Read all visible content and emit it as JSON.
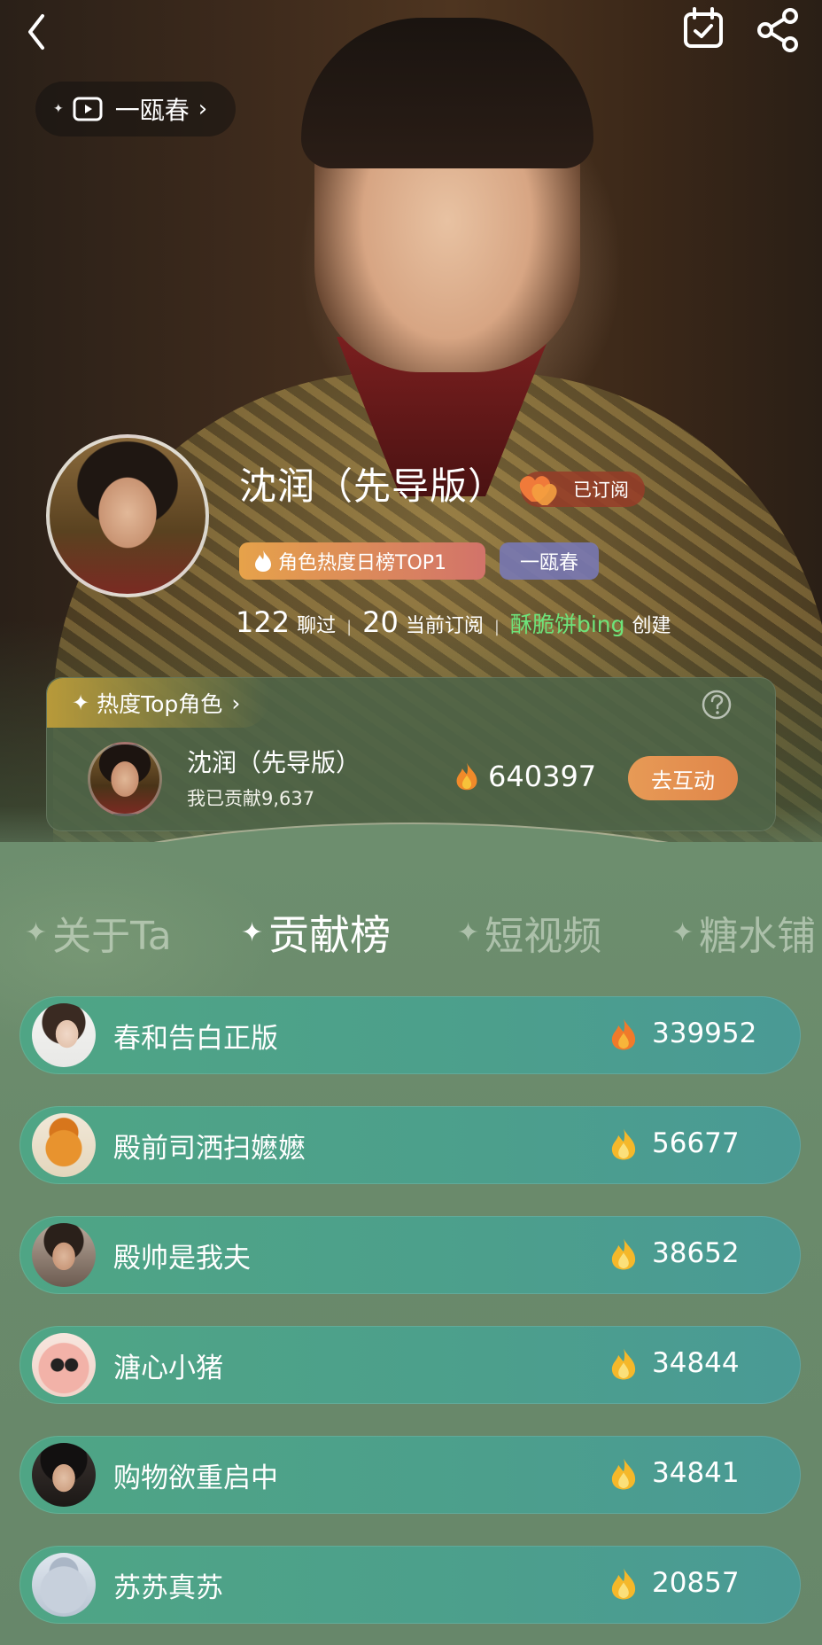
{
  "top_bar": {
    "back_label": "back",
    "series_pill_label": "一瓯春"
  },
  "profile": {
    "name": "沈润（先导版）",
    "subscribed_label": "已订阅",
    "tag_hot": "角色热度日榜TOP1",
    "tag_series": "一瓯春",
    "chat_count": "122",
    "chat_label": "聊过",
    "sub_count": "20",
    "sub_label": "当前订阅",
    "creator_name": "酥脆饼bing",
    "creator_suffix": "创建"
  },
  "hot_card": {
    "title": "热度Top角色",
    "character_name": "沈润（先导版）",
    "contribution": "我已贡献9,637",
    "score": "640397",
    "action_label": "去互动"
  },
  "tabs": [
    {
      "label": "关于Ta",
      "active": false
    },
    {
      "label": "贡献榜",
      "active": true
    },
    {
      "label": "短视频",
      "active": false
    },
    {
      "label": "糖水铺",
      "active": false
    }
  ],
  "ranking": [
    {
      "name": "春和告白正版",
      "score": "339952"
    },
    {
      "name": "殿前司洒扫嬷嬷",
      "score": "56677"
    },
    {
      "name": "殿帅是我夫",
      "score": "38652"
    },
    {
      "name": "溏心小猪",
      "score": "34844"
    },
    {
      "name": "购物欲重启中",
      "score": "34841"
    },
    {
      "name": "苏苏真苏",
      "score": "20857"
    }
  ],
  "colors": {
    "rank_row": "#4fa585",
    "creator": "#6ee37a",
    "interact_button": "#e79a56",
    "fire_first": "#f07a2a",
    "fire_others": "#f5c02a"
  }
}
